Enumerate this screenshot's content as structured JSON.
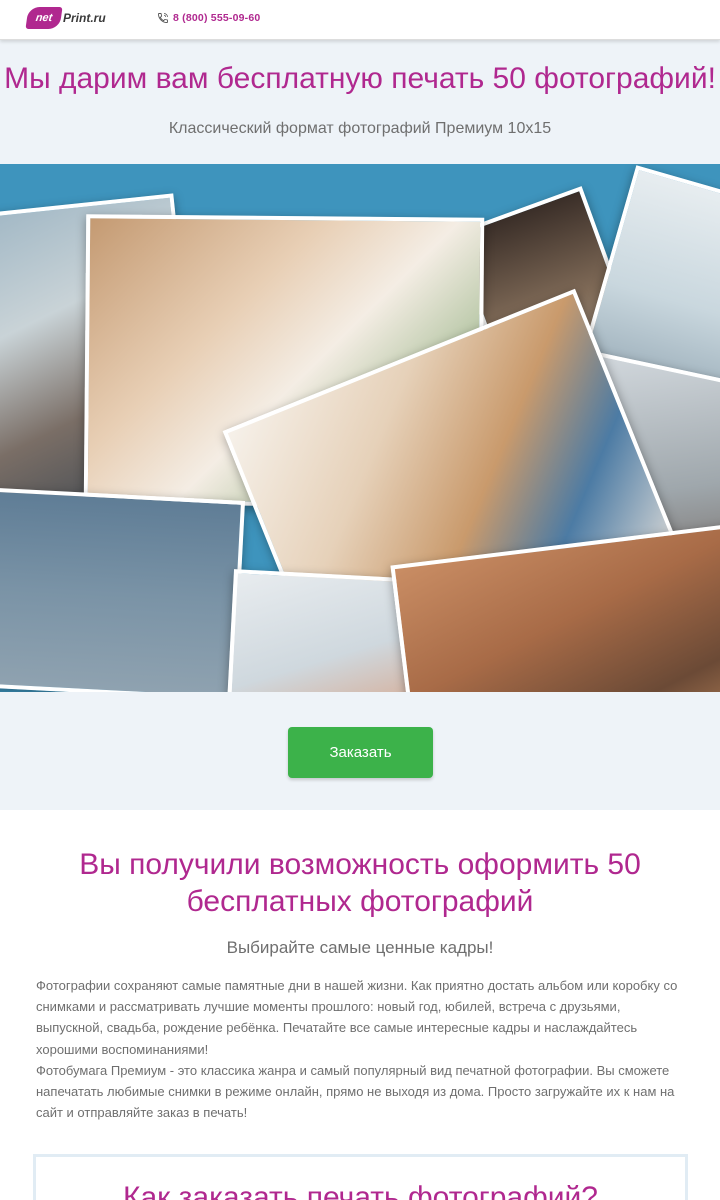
{
  "header": {
    "logo_net": "net",
    "logo_print": "Print.ru",
    "phone_icon": "phone-icon",
    "phone": "8 (800) 555-09-60"
  },
  "hero": {
    "title": "Мы дарим вам бесплатную печать 50 фотографий!",
    "subtitle": "Классический формат фотографий Премиум 10х15"
  },
  "cta": {
    "button": "Заказать"
  },
  "section": {
    "title": "Вы получили возможность оформить 50 бесплатных фотографий",
    "subtitle": "Выбирайте самые ценные кадры!",
    "paragraph1": "Фотографии сохраняют самые памятные дни в нашей жизни. Как приятно достать альбом или коробку со снимками и рассматривать лучшие моменты прошлого: новый год, юбилей, встреча с друзьями, выпускной, свадьба, рождение ребёнка. Печатайте все самые интересные кадры и наслаждайтесь хорошими воспоминаниями!",
    "paragraph2": "Фотобумага Премиум - это классика жанра и самый популярный вид печатной фотографии. Вы сможете напечатать любимые снимки в режиме онлайн, прямо не выходя из дома. Просто загружайте их к нам на сайт и отправляйте заказ в печать!"
  },
  "how_to": {
    "title": "Как заказать печать фотографий?"
  },
  "colors": {
    "brand": "#b0288f",
    "accent_green": "#3cb24a",
    "collage_bg": "#3e94bd",
    "band_bg": "#eef3f8"
  }
}
